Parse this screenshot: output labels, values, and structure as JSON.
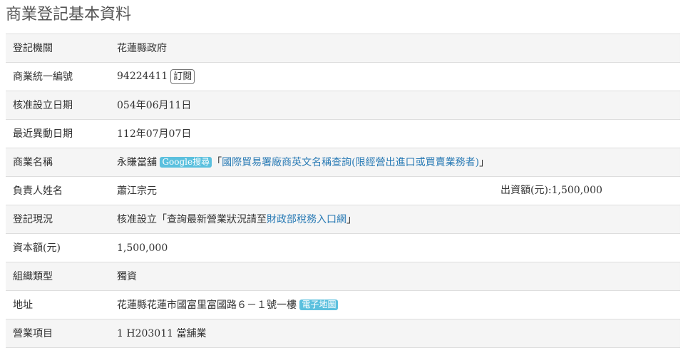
{
  "page": {
    "title": "商業登記基本資料"
  },
  "rows": {
    "authority": {
      "label": "登記機關",
      "value": "花蓮縣政府"
    },
    "ubn": {
      "label": "商業統一編號",
      "value": "94224411",
      "subscribe_label": "訂閱"
    },
    "approve_date": {
      "label": "核准設立日期",
      "value": "054年06月11日"
    },
    "change_date": {
      "label": "最近異動日期",
      "value": "112年07月07日"
    },
    "name": {
      "label": "商業名稱",
      "value": "永賺當舖",
      "google_label": "Google搜尋",
      "bracket_open": "「",
      "trade_link": "國際貿易署廠商英文名稱查詢(限經營出進口或買賣業務者)",
      "bracket_close": "」"
    },
    "owner": {
      "label": "負責人姓名",
      "value": "蕭江宗元",
      "contribution": "出資額(元):1,500,000"
    },
    "status": {
      "label": "登記現況",
      "value": "核准設立",
      "prefix": "「查詢最新營業狀況請至",
      "tax_link": "財政部稅務入口網",
      "suffix": "」"
    },
    "capital": {
      "label": "資本額(元)",
      "value": "1,500,000"
    },
    "org_type": {
      "label": "組織類型",
      "value": "獨資"
    },
    "address": {
      "label": "地址",
      "value": "花蓮縣花蓮市國富里富國路６－１號一樓",
      "map_label": "電子地圖"
    },
    "business": {
      "label": "營業項目",
      "value": "1 H203011 當舖業"
    }
  }
}
